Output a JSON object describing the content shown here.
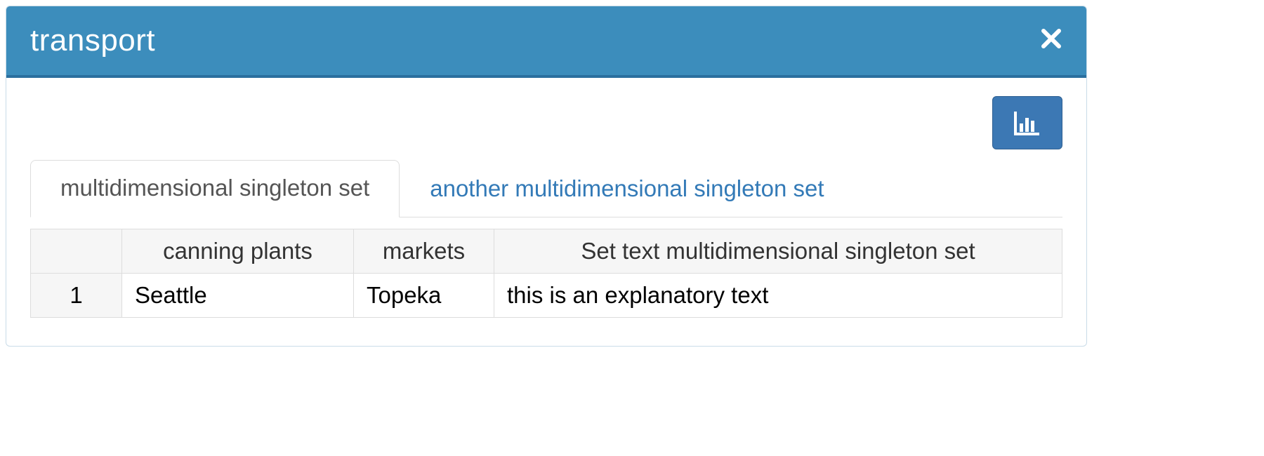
{
  "panel": {
    "title": "transport"
  },
  "tabs": [
    {
      "label": "multidimensional singleton set",
      "active": true
    },
    {
      "label": "another multidimensional singleton set",
      "active": false
    }
  ],
  "table": {
    "headers": [
      "",
      "canning plants",
      "markets",
      "Set text multidimensional singleton set"
    ],
    "rows": [
      {
        "num": "1",
        "cells": [
          "Seattle",
          "Topeka",
          "this is an explanatory text"
        ]
      }
    ]
  }
}
